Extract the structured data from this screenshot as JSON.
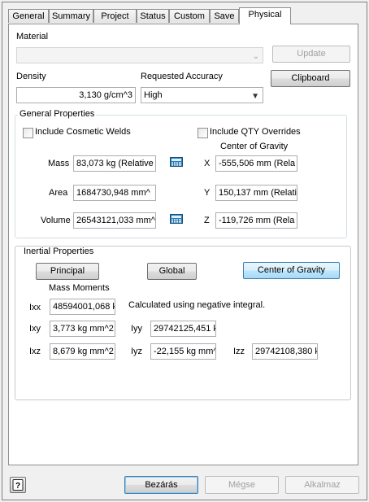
{
  "tabs": [
    "General",
    "Summary",
    "Project",
    "Status",
    "Custom",
    "Save",
    "Physical"
  ],
  "material": {
    "label": "Material",
    "value": "",
    "update_button": "Update"
  },
  "density": {
    "label": "Density",
    "value": "3,130 g/cm^3"
  },
  "accuracy": {
    "label": "Requested Accuracy",
    "value": "High",
    "clipboard_button": "Clipboard"
  },
  "general_properties": {
    "title": "General Properties",
    "include_cosmetic_welds": "Include Cosmetic Welds",
    "include_qty_overrides": "Include QTY Overrides",
    "cog_label": "Center of Gravity",
    "mass_label": "Mass",
    "mass_value": "83,073 kg (Relative",
    "area_label": "Area",
    "area_value": "1684730,948 mm^",
    "volume_label": "Volume",
    "volume_value": "26543121,033 mm^",
    "x_label": "X",
    "x_value": "-555,506 mm (Rela",
    "y_label": "Y",
    "y_value": "150,137 mm (Relati",
    "z_label": "Z",
    "z_value": "-119,726 mm (Rela"
  },
  "inertial_properties": {
    "title": "Inertial Properties",
    "principal_button": "Principal",
    "global_button": "Global",
    "cog_button": "Center of Gravity",
    "mass_moments_label": "Mass Moments",
    "note": "Calculated using negative integral.",
    "ixx_label": "Ixx",
    "ixx_value": "48594001,068 k",
    "ixy_label": "Ixy",
    "ixy_value": "3,773 kg mm^2",
    "iyy_label": "Iyy",
    "iyy_value": "29742125,451 k",
    "ixz_label": "Ixz",
    "ixz_value": "8,679 kg mm^2",
    "iyz_label": "Iyz",
    "iyz_value": "-22,155 kg mm^",
    "izz_label": "Izz",
    "izz_value": "29742108,380 k"
  },
  "footer": {
    "close_button": "Bezárás",
    "cancel_button": "Mégse",
    "apply_button": "Alkalmaz"
  },
  "icons": {
    "help": "help-icon",
    "calculator": "calculator-icon"
  },
  "colors": {
    "active_button": "#bee6fd",
    "panel_bg": "#ffffff",
    "window_bg": "#f0f0f0"
  }
}
